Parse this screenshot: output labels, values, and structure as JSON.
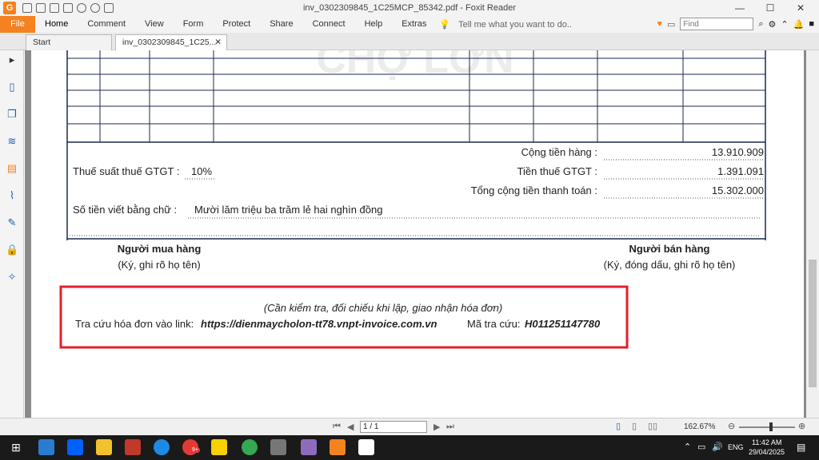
{
  "window": {
    "title": "inv_0302309845_1C25MCP_85342.pdf - Foxit Reader",
    "logo": "G"
  },
  "menu": {
    "file": "File",
    "items": [
      "Home",
      "Comment",
      "View",
      "Form",
      "Protect",
      "Share",
      "Connect",
      "Help",
      "Extras"
    ],
    "tell_me": "Tell me what you want to do..",
    "find_placeholder": "Find"
  },
  "tabs": [
    {
      "label": "Start"
    },
    {
      "label": "inv_0302309845_1C25..."
    }
  ],
  "invoice": {
    "watermark": "CHỢ LỚN",
    "totals": [
      {
        "label": "Cộng tiền hàng :",
        "value": "13.910.909"
      },
      {
        "label": "Tiền thuế GTGT :",
        "value": "1.391.091"
      },
      {
        "label": "Tổng cộng tiền thanh toán :",
        "value": "15.302.000"
      }
    ],
    "vat_rate_label": "Thuế suất thuế GTGT :",
    "vat_rate_value": "10%",
    "amount_words_label": "Số tiền viết bằng chữ :",
    "amount_words_value": "Mười lăm triệu ba trăm lẻ hai nghìn đồng",
    "buyer_title": "Người mua hàng",
    "buyer_note": "(Ký, ghi rõ họ tên)",
    "seller_title": "Người bán hàng",
    "seller_note": "(Ký, đóng dấu, ghi rõ họ tên)",
    "lookup_note": "(Cần kiểm tra, đối chiếu khi lập, giao nhận hóa đơn)",
    "lookup_link_label": "Tra cứu hóa đơn vào link:",
    "lookup_link": "https://dienmaycholon-tt78.vnpt-invoice.com.vn",
    "lookup_code_label": "Mã tra cứu:",
    "lookup_code": "H011251147780"
  },
  "status": {
    "page": "1 / 1",
    "zoom": "162.67%"
  },
  "taskbar": {
    "language": "ENG",
    "time": "11:42 AM",
    "date": "29/04/2025",
    "badge": "9+"
  },
  "colors": {
    "accent": "#f58220",
    "highlight_box": "#e2202a",
    "table_border": "#1a2a4a"
  }
}
